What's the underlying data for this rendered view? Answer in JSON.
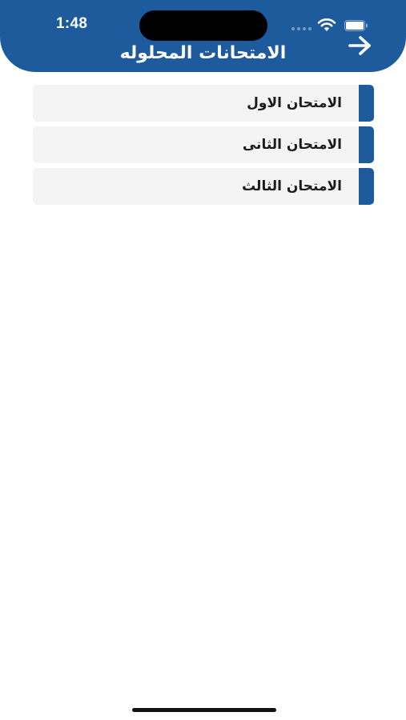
{
  "status_bar": {
    "time": "1:48",
    "icons": [
      "signal-dots-icon",
      "wifi-icon",
      "battery-icon"
    ]
  },
  "header": {
    "title": "الامتحانات المحلوله",
    "back_icon": "arrow-right-icon"
  },
  "exams": [
    {
      "label": "الامتحان الاول"
    },
    {
      "label": "الامتحان الثانى"
    },
    {
      "label": "الامتحان الثالث"
    }
  ],
  "colors": {
    "primary": "#1d5b9c",
    "card_background": "#f4f4f4",
    "text": "#1c1c1c",
    "page_background": "#ffffff"
  }
}
